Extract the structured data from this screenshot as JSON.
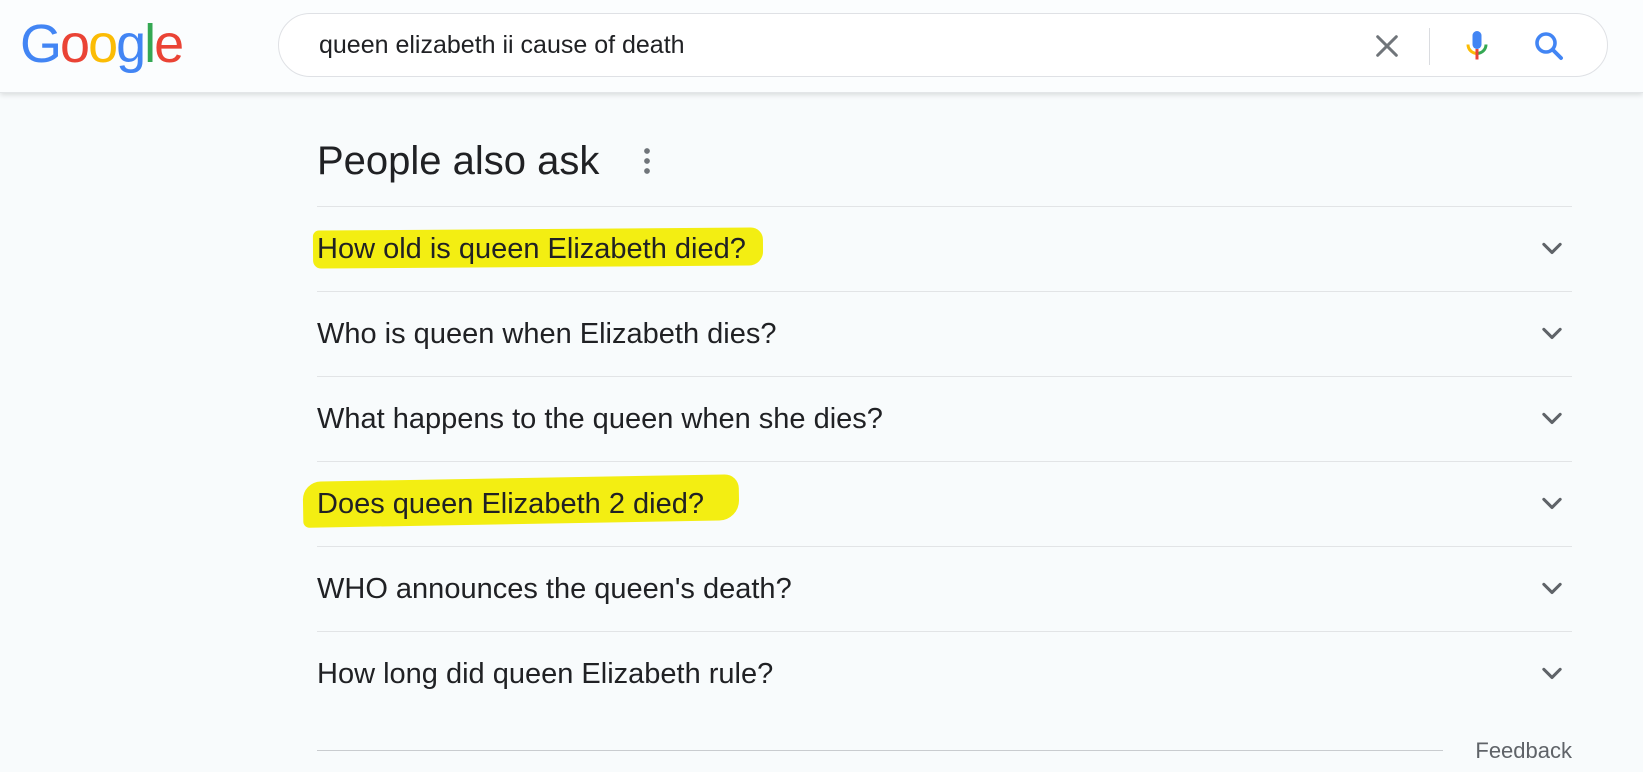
{
  "header": {
    "logo": {
      "letters": [
        "G",
        "o",
        "o",
        "g",
        "l",
        "e"
      ],
      "colors": [
        "#4285F4",
        "#EA4335",
        "#FBBC05",
        "#4285F4",
        "#34A853",
        "#EA4335"
      ]
    },
    "search": {
      "value": "queen elizabeth ii cause of death"
    },
    "icons": {
      "clear": "close-icon",
      "voice": "microphone-icon",
      "search": "search-icon"
    }
  },
  "people_also_ask": {
    "title": "People also ask",
    "more_icon": "more-vert-icon",
    "questions": [
      {
        "text": "How old is queen Elizabeth died?",
        "highlighted": true
      },
      {
        "text": "Who is queen when Elizabeth dies?",
        "highlighted": false
      },
      {
        "text": "What happens to the queen when she dies?",
        "highlighted": false
      },
      {
        "text": "Does queen Elizabeth 2 died?",
        "highlighted": true
      },
      {
        "text": "WHO announces the queen's death?",
        "highlighted": false
      },
      {
        "text": "How long did queen Elizabeth rule?",
        "highlighted": false
      }
    ],
    "feedback": "Feedback"
  },
  "colors": {
    "page_bg": "#f8fbfc",
    "highlight": "#f3ee12",
    "text": "#202124",
    "secondary_text": "#5f6368"
  }
}
